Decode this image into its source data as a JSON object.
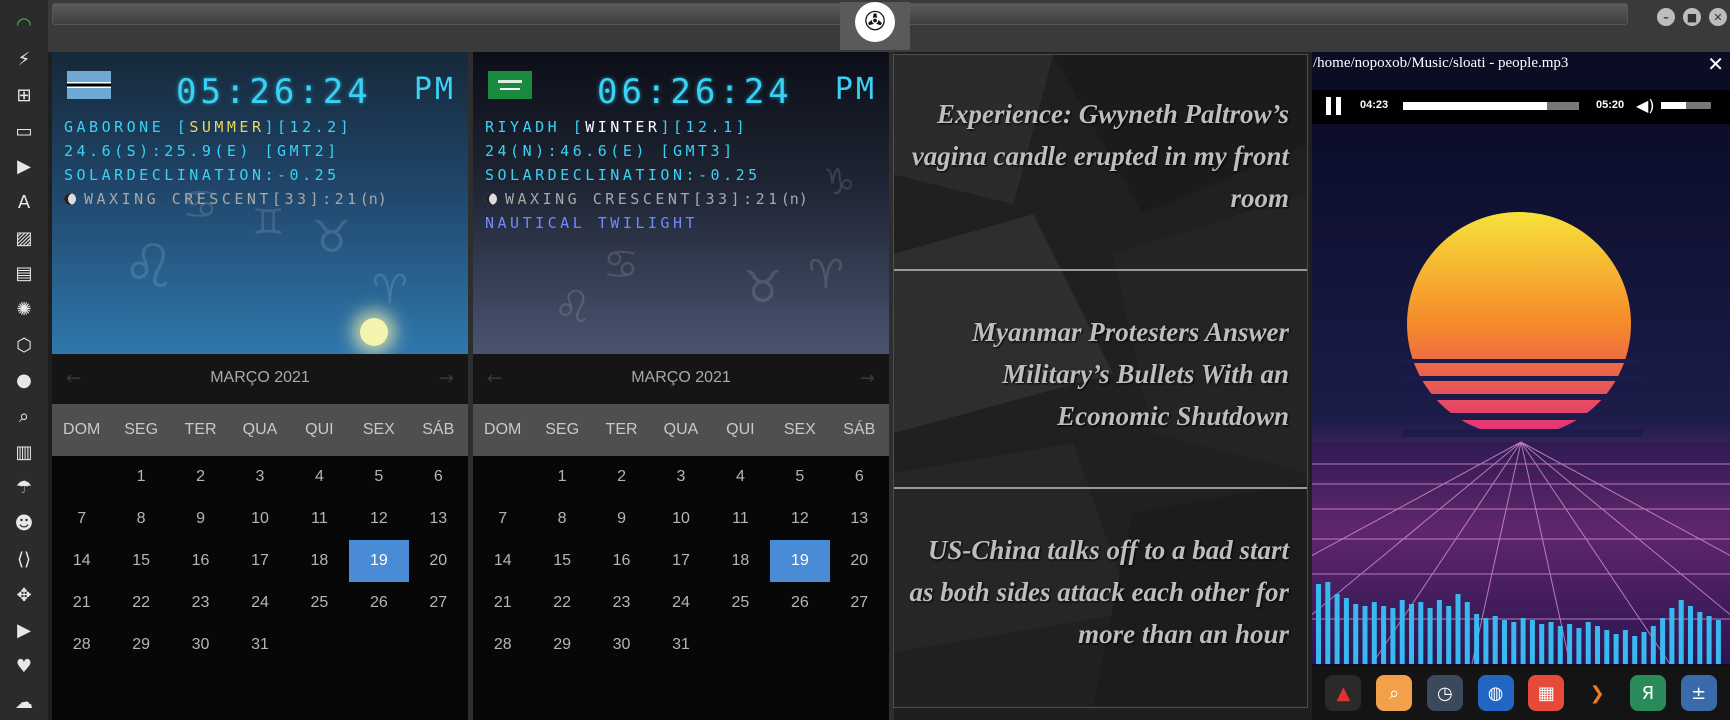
{
  "rail": {
    "items": [
      {
        "name": "wifi-icon",
        "glyph": "◠"
      },
      {
        "name": "lightning-icon",
        "glyph": "⚡"
      },
      {
        "name": "windows-icon",
        "glyph": "⊞"
      },
      {
        "name": "archive-icon",
        "glyph": "▭"
      },
      {
        "name": "play-circle-icon",
        "glyph": "▶"
      },
      {
        "name": "translate-icon",
        "glyph": "A"
      },
      {
        "name": "image-icon",
        "glyph": "▨"
      },
      {
        "name": "newspaper-icon",
        "glyph": "▤"
      },
      {
        "name": "empire-icon",
        "glyph": "✺"
      },
      {
        "name": "hexagon-icon",
        "glyph": "⬡"
      },
      {
        "name": "globe-icon",
        "glyph": "●"
      },
      {
        "name": "search-icon",
        "glyph": "⌕"
      },
      {
        "name": "map-icon",
        "glyph": "▥"
      },
      {
        "name": "umbrella-icon",
        "glyph": "☂"
      },
      {
        "name": "contact-card-icon",
        "glyph": "☻"
      },
      {
        "name": "code-icon",
        "glyph": "⟨⟩"
      },
      {
        "name": "expand-icon",
        "glyph": "✥"
      },
      {
        "name": "youtube-icon",
        "glyph": "▶"
      },
      {
        "name": "heart-icon",
        "glyph": "♥"
      },
      {
        "name": "cloud-icon",
        "glyph": "☁"
      }
    ]
  },
  "window": {
    "minimize": "–",
    "maximize": "■",
    "close": "✕"
  },
  "clocks": [
    {
      "time": "05:26:24",
      "ampm": "PM",
      "line1_prefix": "GABORONE [",
      "line1_season": "SUMMER",
      "line1_suffix": "][12.2]",
      "line2": "24.6(S):25.9(E) [GMT2]",
      "line3": "SOLARDECLINATION:-0.25",
      "line4": "WAXING CRESCENT[33]:21",
      "line4_tail": "(n)",
      "line5": ""
    },
    {
      "time": "06:26:24",
      "ampm": "PM",
      "line1_prefix": "RIYADH [",
      "line1_season": "WINTER",
      "line1_suffix": "][12.1]",
      "line2": "24(N):46.6(E) [GMT3]",
      "line3": "SOLARDECLINATION:-0.25",
      "line4": "WAXING CRESCENT[33]:21",
      "line4_tail": "(n)",
      "line5": "NAUTICAL TWILIGHT"
    }
  ],
  "calendars": [
    {
      "month": "MARÇO 2021",
      "prev": "←",
      "next": "→",
      "dow": [
        "DOM",
        "SEG",
        "TER",
        "QUA",
        "QUI",
        "SEX",
        "SÁB"
      ],
      "days": [
        "",
        "1",
        "2",
        "3",
        "4",
        "5",
        "6",
        "7",
        "8",
        "9",
        "10",
        "11",
        "12",
        "13",
        "14",
        "15",
        "16",
        "17",
        "18",
        "19",
        "20",
        "21",
        "22",
        "23",
        "24",
        "25",
        "26",
        "27",
        "28",
        "29",
        "30",
        "31"
      ],
      "today": "19"
    },
    {
      "month": "MARÇO 2021",
      "prev": "←",
      "next": "→",
      "dow": [
        "DOM",
        "SEG",
        "TER",
        "QUA",
        "QUI",
        "SEX",
        "SÁB"
      ],
      "days": [
        "",
        "1",
        "2",
        "3",
        "4",
        "5",
        "6",
        "7",
        "8",
        "9",
        "10",
        "11",
        "12",
        "13",
        "14",
        "15",
        "16",
        "17",
        "18",
        "19",
        "20",
        "21",
        "22",
        "23",
        "24",
        "25",
        "26",
        "27",
        "28",
        "29",
        "30",
        "31"
      ],
      "today": "19"
    }
  ],
  "news": [
    {
      "title": "Experience: Gwyneth Paltrow’s vagina candle erupted in my front room"
    },
    {
      "title": "Myanmar Protesters Answer Military’s Bullets With an Economic Shutdown"
    },
    {
      "title": "US-China talks off to a bad start as both sides attack each other for more than an hour"
    }
  ],
  "player": {
    "path": "/home/nopoxob/Music/sloati - people.mp3",
    "close": "✕",
    "elapsed": "04:23",
    "total": "05:20",
    "progress": 0.82,
    "volume": 0.5,
    "volume_icon": "🔊"
  },
  "dock": [
    {
      "name": "dock-app-red-triangle",
      "glyph": "▲",
      "bg": "#2a2a2a",
      "color": "#e03030"
    },
    {
      "name": "dock-app-search",
      "glyph": "⌕",
      "bg": "#f2a04a",
      "color": "#ffffff"
    },
    {
      "name": "dock-app-clock",
      "glyph": "◷",
      "bg": "#3a4a5a",
      "color": "#ffffff"
    },
    {
      "name": "dock-app-globe",
      "glyph": "◍",
      "bg": "#2266c4",
      "color": "#ffffff"
    },
    {
      "name": "dock-app-calendar",
      "glyph": "▦",
      "bg": "#e84a3a",
      "color": "#ffffff"
    },
    {
      "name": "dock-app-arrow",
      "glyph": "❯",
      "bg": "#141414",
      "color": "#f07820"
    },
    {
      "name": "dock-app-yandex",
      "glyph": "Я",
      "bg": "#2a8a5a",
      "color": "#ffffff"
    },
    {
      "name": "dock-app-calculator",
      "glyph": "±",
      "bg": "#3a6aaa",
      "color": "#ffffff"
    }
  ],
  "colors": {
    "clock_text": "#39d2f5",
    "season_highlight": "#e9d85a",
    "twilight": "#6d8bff",
    "today": "#4a8bd6"
  }
}
